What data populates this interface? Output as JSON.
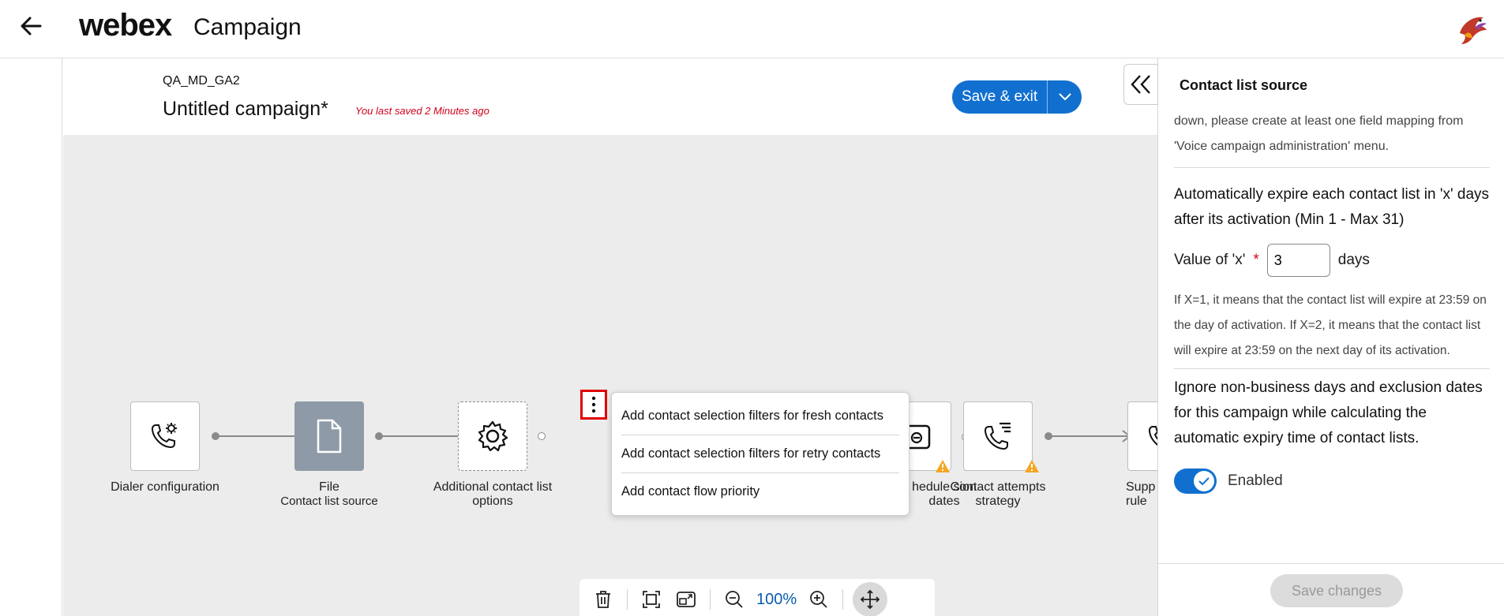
{
  "header": {
    "brand": "webex",
    "product": "Campaign"
  },
  "campaign": {
    "team": "QA_MD_GA2",
    "title": "Untitled campaign*",
    "saved_note": "You last saved 2 Minutes ago",
    "save_label": "Save & exit"
  },
  "flow": {
    "nodes": [
      {
        "label": "Dialer configuration",
        "sub": ""
      },
      {
        "label": "File",
        "sub": "Contact list source"
      },
      {
        "label": "Additional contact list options",
        "sub": ""
      },
      {
        "label": "hedule sion dates",
        "sub": ""
      },
      {
        "label": "Contact attempts strategy",
        "sub": ""
      },
      {
        "label": "Supp rule",
        "sub": ""
      }
    ]
  },
  "menu": {
    "items": [
      "Add contact selection filters for fresh contacts",
      "Add contact selection filters for retry contacts",
      "Add contact flow priority"
    ]
  },
  "zoom": {
    "value": "100%"
  },
  "panel": {
    "title": "Contact list source",
    "intro_cut": "down, please create at least one field mapping from 'Voice campaign administration' menu.",
    "expire_text": "Automatically expire each contact list in 'x' days after its activation (Min 1 - Max 31)",
    "value_label": "Value of 'x'",
    "value": "3",
    "unit": "days",
    "help": "If X=1, it means that the contact list will expire at 23:59 on the day of activation. If X=2, it means that the contact list will expire at 23:59 on the next day of its activation.",
    "ignore_text": "Ignore non-business days and exclusion dates for this campaign while calculating the automatic expiry time of contact lists.",
    "toggle_label": "Enabled",
    "save_changes": "Save changes"
  }
}
